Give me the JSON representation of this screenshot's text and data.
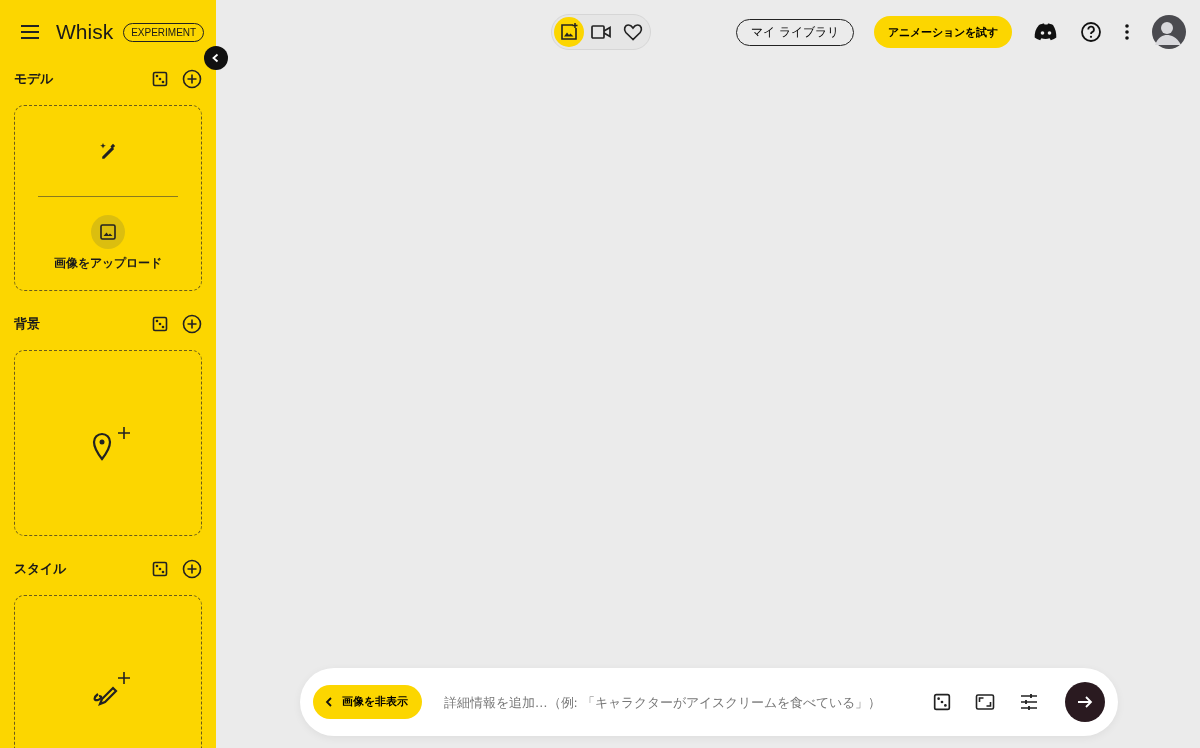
{
  "sidebar": {
    "logo": "Whisk",
    "badge": "EXPERIMENT",
    "sections": [
      {
        "title": "モデル",
        "kind": "model",
        "upload_label": "画像をアップロード"
      },
      {
        "title": "背景",
        "kind": "location"
      },
      {
        "title": "スタイル",
        "kind": "style"
      }
    ]
  },
  "mode_toggle": [
    {
      "kind": "image",
      "selected": true
    },
    {
      "kind": "video",
      "selected": false
    },
    {
      "kind": "favorites",
      "selected": false
    }
  ],
  "header": {
    "library_button": "マイ ライブラリ",
    "animate_button": "アニメーションを試す"
  },
  "prompt_bar": {
    "hide_images_button": "画像を非表示",
    "placeholder": "詳細情報を追加…（例: 「キャラクターがアイスクリームを食べている」）"
  }
}
